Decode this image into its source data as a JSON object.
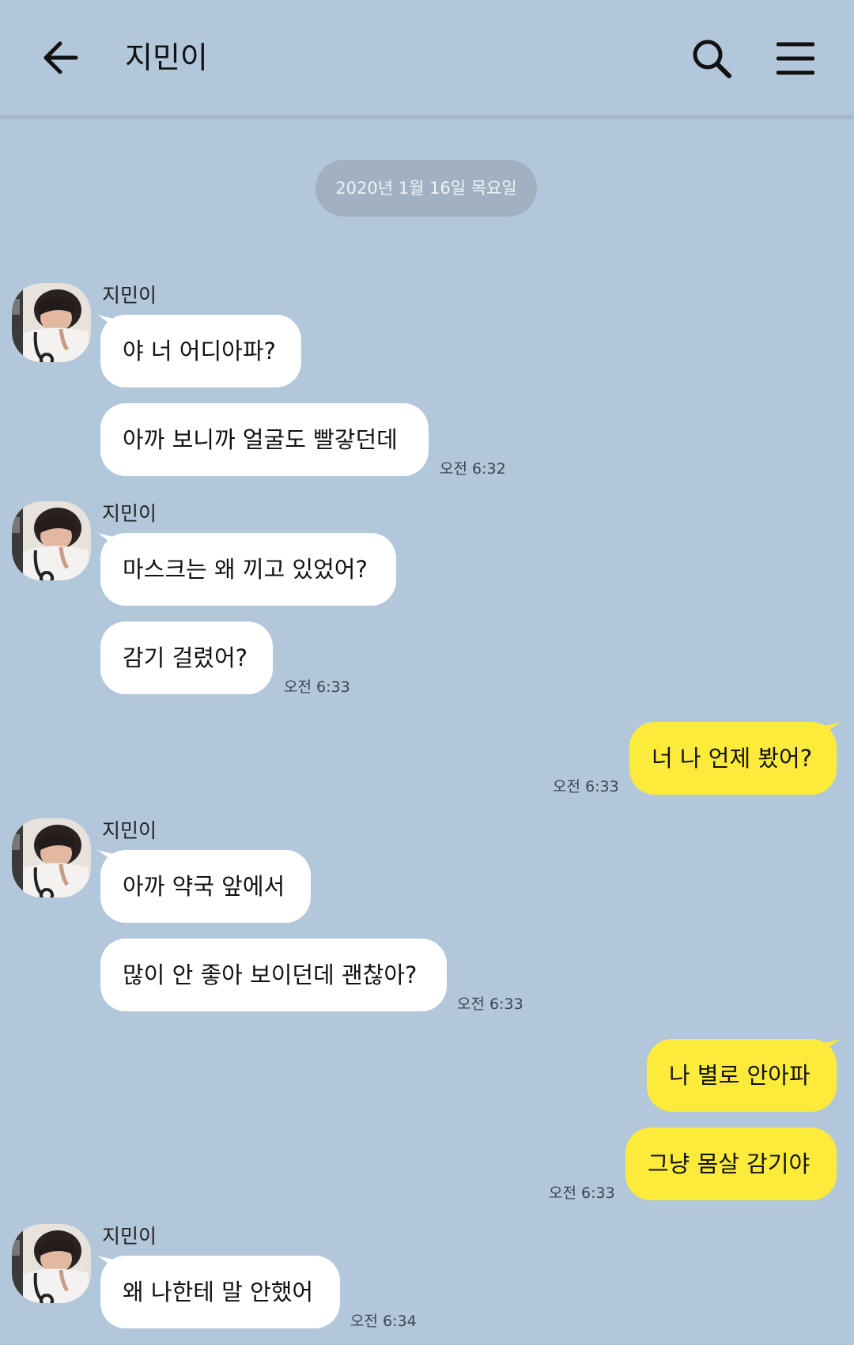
{
  "header": {
    "title": "지민이",
    "back_icon": "arrow-left-icon",
    "search_icon": "search-icon",
    "menu_icon": "hamburger-menu-icon"
  },
  "date_divider": "2020년 1월 16일 목요일",
  "colors": {
    "background": "#b2c7da",
    "incoming_bubble": "#ffffff",
    "outgoing_bubble": "#fceb3b",
    "date_pill": "#a1b1c1"
  },
  "messages": [
    {
      "sender": "지민이",
      "text": "야 너 어디아파?"
    },
    {
      "text": "아까 보니까 얼굴도 빨갛던데",
      "time": "오전 6:32"
    },
    {
      "sender": "지민이",
      "text": "마스크는 왜 끼고 있었어?"
    },
    {
      "text": "감기 걸렸어?",
      "time": "오전 6:33"
    },
    {
      "text": "너 나 언제 봤어?",
      "time": "오전 6:33"
    },
    {
      "sender": "지민이",
      "text": "아까 약국 앞에서"
    },
    {
      "text": "많이 안 좋아 보이던데 괜찮아?",
      "time": "오전 6:33"
    },
    {
      "text": "나 별로 안아파"
    },
    {
      "text": "그냥 몸살 감기야",
      "time": "오전 6:33"
    },
    {
      "sender": "지민이",
      "text": "왜 나한테 말 안했어",
      "time": "오전 6:34"
    }
  ]
}
